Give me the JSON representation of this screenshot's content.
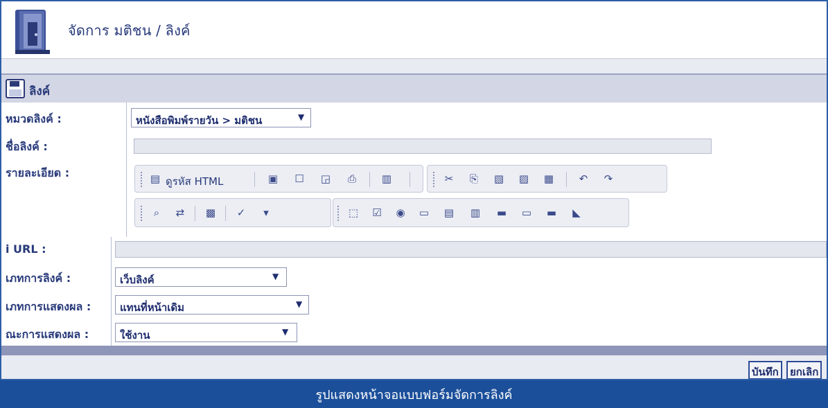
{
  "header": {
    "title": "จัดการ มติชน / ลิงค์"
  },
  "section": {
    "label": "ลิงค์"
  },
  "form": {
    "category_label": "หมวดลิงค์ :",
    "category_value": "หนังสือพิมพ์รายวัน > มติชน",
    "name_label": "ชื่อลิงค์ :",
    "name_value": "",
    "detail_label": "รายละเอียด :",
    "url_label": "i URL :",
    "url_value": "",
    "link_type_label": "เภทการลิงค์ :",
    "link_type_value": "เว็บลิงค์",
    "display_type_label": "เภทการแสดงผล :",
    "display_type_value": "แทนที่หน้าเดิม",
    "status_label": "ณะการแสดงผล :",
    "status_value": "ใช้งาน"
  },
  "toolbar": {
    "source_label": "ดูรหัส HTML"
  },
  "buttons": {
    "save": "บันทึก",
    "cancel": "ยกเลิก"
  },
  "caption": "รูปแสดงหน้าจอแบบฟอร์มจัดการลิงค์",
  "colors": {
    "accent": "#2d5ea7",
    "label": "#283a7a",
    "caption_bg": "#1b4f9a"
  }
}
